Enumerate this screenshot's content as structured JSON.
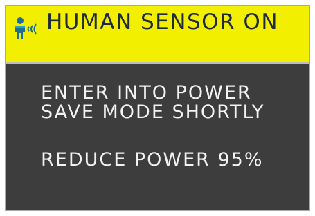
{
  "osd": {
    "header": {
      "icon": "human-sensor-icon",
      "title": "HUMAN SENSOR ON",
      "accent_color": "#f2ef00"
    },
    "message": {
      "line1": "ENTER INTO POWER",
      "line2": "SAVE MODE SHORTLY",
      "line3": "REDUCE POWER 95%"
    },
    "background_color": "#3d3d3d",
    "text_color": "#f2f2f2"
  }
}
